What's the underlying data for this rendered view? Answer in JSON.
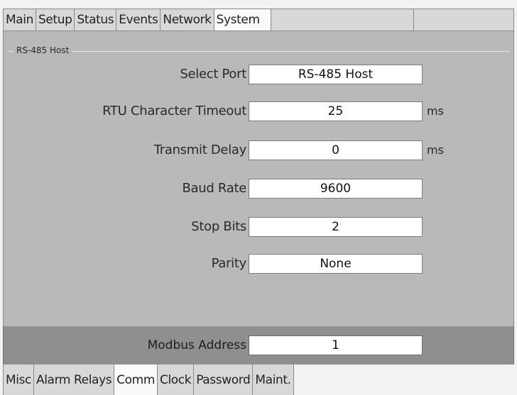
{
  "top_tabs": [
    {
      "label": "Main",
      "active": false
    },
    {
      "label": "Setup",
      "active": false
    },
    {
      "label": "Status",
      "active": false
    },
    {
      "label": "Events",
      "active": false
    },
    {
      "label": "Network",
      "active": false
    },
    {
      "label": "System",
      "active": true
    }
  ],
  "group": {
    "title": "RS-485 Host"
  },
  "fields": [
    {
      "label": "Select Port",
      "value": "RS-485 Host",
      "unit": ""
    },
    {
      "label": "RTU Character Timeout",
      "value": "25",
      "unit": "ms"
    },
    {
      "label": "Transmit Delay",
      "value": "0",
      "unit": "ms"
    },
    {
      "label": "Baud Rate",
      "value": "9600",
      "unit": ""
    },
    {
      "label": "Stop Bits",
      "value": "2",
      "unit": ""
    },
    {
      "label": "Parity",
      "value": "None",
      "unit": ""
    }
  ],
  "modbus": {
    "label": "Modbus Address",
    "value": "1"
  },
  "bottom_tabs": [
    {
      "label": "Misc",
      "active": false
    },
    {
      "label": "Alarm Relays",
      "active": false
    },
    {
      "label": "Comm",
      "active": true
    },
    {
      "label": "Clock",
      "active": false
    },
    {
      "label": "Password",
      "active": false
    },
    {
      "label": "Maint.",
      "active": false
    }
  ]
}
